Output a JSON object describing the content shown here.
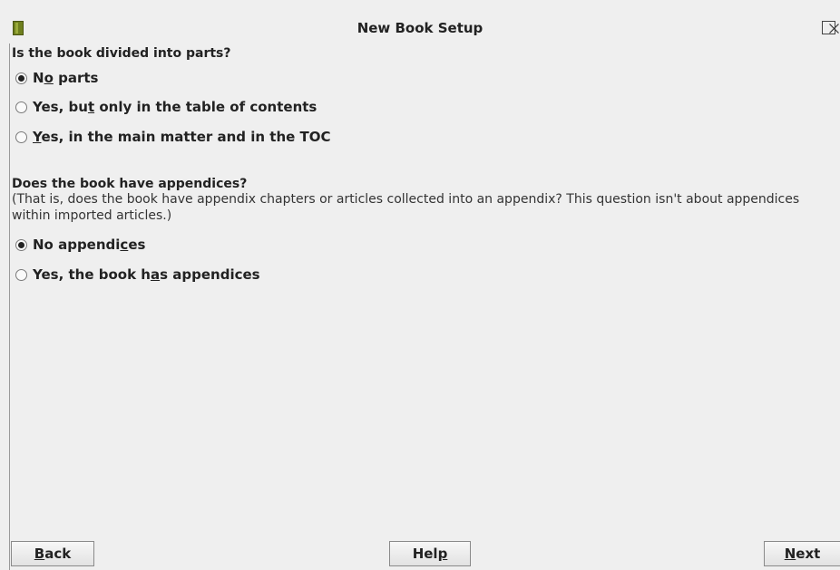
{
  "window": {
    "title": "New Book Setup",
    "icon": "book-icon",
    "close_icon": "close-icon"
  },
  "parts_question": {
    "heading": "Is the book divided into parts?",
    "options": [
      {
        "label": "No parts",
        "mnemonic": "o",
        "selected": true
      },
      {
        "label": "Yes, but only in the table of contents",
        "mnemonic": "t",
        "selected": false
      },
      {
        "label": "Yes, in the main matter and in the TOC",
        "mnemonic": "Y",
        "selected": false
      }
    ]
  },
  "appendices_question": {
    "heading": "Does the book have appendices?",
    "note": "(That is, does the book have appendix chapters or articles collected into an appendix? This question isn't about appendices within imported articles.)",
    "options": [
      {
        "label": "No appendices",
        "mnemonic": "c",
        "selected": true
      },
      {
        "label": "Yes, the book has appendices",
        "mnemonic": "a",
        "selected": false
      }
    ]
  },
  "buttons": {
    "back": {
      "label": "Back",
      "mnemonic": "B"
    },
    "help": {
      "label": "Help",
      "mnemonic": "p"
    },
    "next": {
      "label": "Next",
      "mnemonic": "N"
    }
  },
  "colors": {
    "window_bg": "#efefef",
    "icon_green": "#6e7f1e"
  }
}
